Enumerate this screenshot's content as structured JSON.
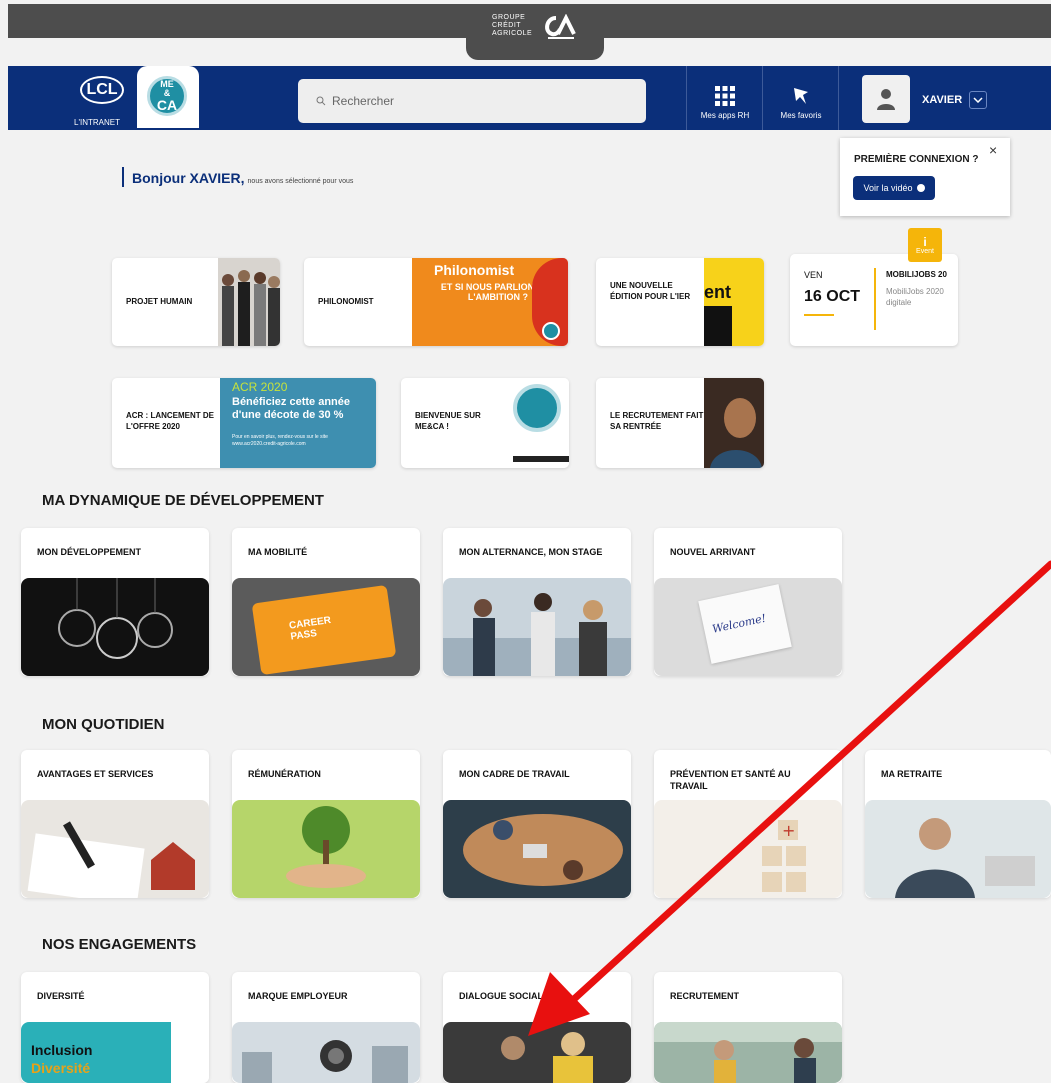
{
  "brand": {
    "line1": "GROUPE",
    "line2": "CRÉDIT",
    "line3": "AGRICOLE"
  },
  "header": {
    "lcl_logo": "LCL",
    "lcl_sub": "L'INTRANET",
    "meca_logo": [
      "ME",
      "&",
      "CA"
    ],
    "search_placeholder": "Rechercher",
    "apps_label": "Mes apps RH",
    "favoris_label": "Mes favoris",
    "user_name": "XAVIER"
  },
  "popup": {
    "title": "PREMIÈRE CONNEXION ?",
    "close": "×",
    "button": "Voir la vidéo"
  },
  "greeting": {
    "main": "Bonjour XAVIER,",
    "sub": "nous avons sélectionné pour vous"
  },
  "news": [
    {
      "label": "PROJET HUMAIN"
    },
    {
      "label": "PHILONOMIST",
      "img_title": "Philonomist",
      "img_text": "ET SI NOUS PARLIONS DE L'AMBITION ?"
    },
    {
      "label": "UNE NOUVELLE ÉDITION POUR L'IER",
      "img_text": "ent"
    },
    {
      "label": "ACR : LANCEMENT DE L'OFFRE 2020",
      "img_title": "ACR 2020",
      "img_text": "Bénéficiez cette année d'une décote de 30 %",
      "img_small": "Pour en savoir plus, rendez-vous sur le site www.acr2020.credit-agricole.com"
    },
    {
      "label": "BIENVENUE SUR ME&CA !"
    },
    {
      "label": "LE RECRUTEMENT FAIT SA RENTRÉE"
    }
  ],
  "event": {
    "badge_text": "Event",
    "day": "VEN",
    "date": "16 OCT",
    "title": "MOBILIJOBS 20",
    "desc": "MobiliJobs 2020 digitale"
  },
  "sections": [
    {
      "title": "MA DYNAMIQUE DE DÉVELOPPEMENT",
      "tiles": [
        "MON DÉVELOPPEMENT",
        "MA MOBILITÉ",
        "MON ALTERNANCE, MON STAGE",
        "NOUVEL ARRIVANT"
      ]
    },
    {
      "title": "MON QUOTIDIEN",
      "tiles": [
        "AVANTAGES ET SERVICES",
        "RÉMUNÉRATION",
        "MON CADRE DE TRAVAIL",
        "PRÉVENTION ET SANTÉ AU TRAVAIL",
        "MA RETRAITE"
      ]
    },
    {
      "title": "NOS ENGAGEMENTS",
      "tiles": [
        "DIVERSITÉ",
        "MARQUE EMPLOYEUR",
        "DIALOGUE SOCIAL",
        "RECRUTEMENT"
      ]
    }
  ],
  "tile_images": {
    "career_pass": "CAREER PASS",
    "welcome": "Welcome!",
    "inclusion": "Inclusion",
    "diversite": "Diversité"
  },
  "colors": {
    "header_blue": "#0b2f7a",
    "brand_grey": "#4d4d4d",
    "event_yellow": "#f5b50a",
    "arrow_red": "#e8100f"
  }
}
